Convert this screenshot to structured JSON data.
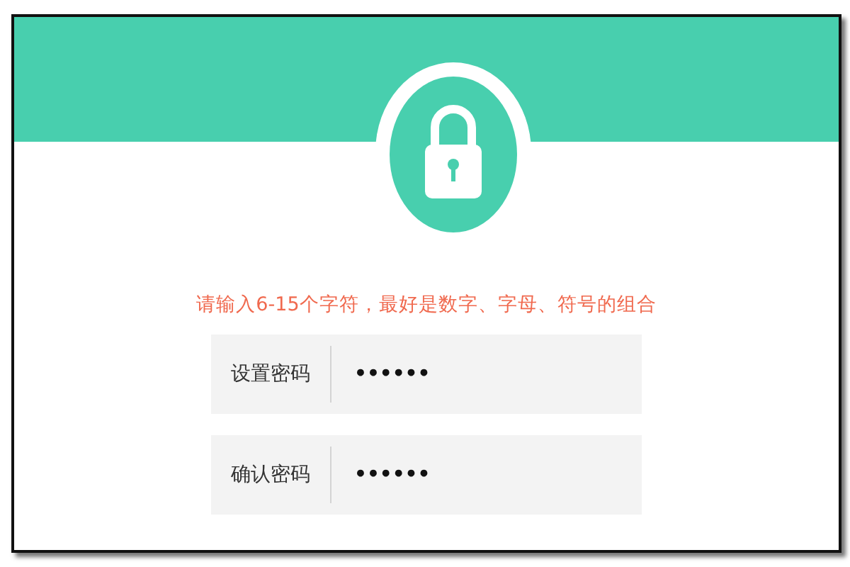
{
  "hint": "请输入6-15个字符，最好是数字、字母、符号的组合",
  "fields": [
    {
      "label": "设置密码",
      "value": "••••••"
    },
    {
      "label": "确认密码",
      "value": "••••••"
    }
  ]
}
